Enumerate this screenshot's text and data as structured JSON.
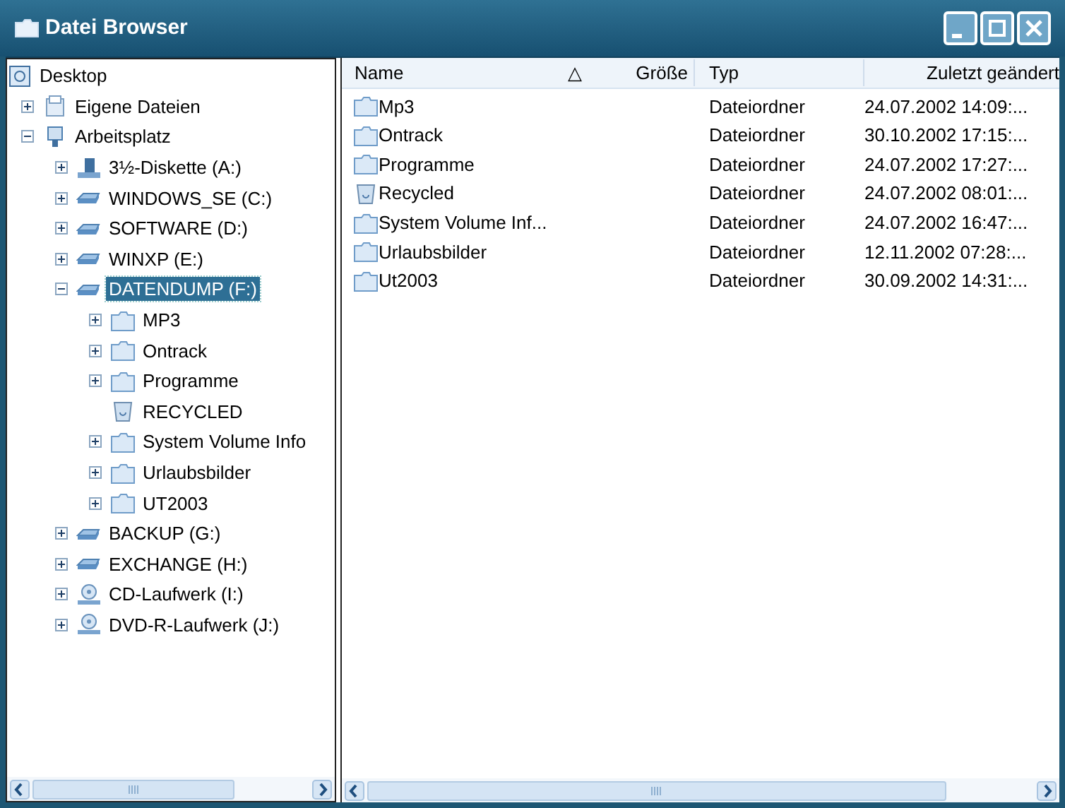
{
  "window": {
    "title": "Datei Browser"
  },
  "tree": [
    {
      "label": "Desktop",
      "kind": "desktop",
      "selected": false,
      "children": [
        {
          "label": "Eigene Dateien",
          "kind": "documents",
          "expanded": false,
          "selected": false
        },
        {
          "label": "Arbeitsplatz",
          "kind": "computer",
          "expanded": true,
          "selected": false,
          "children": [
            {
              "label": "3½-Diskette (A:)",
              "kind": "floppy",
              "expanded": false,
              "selected": false
            },
            {
              "label": "WINDOWS_SE (C:)",
              "kind": "drive",
              "expanded": false,
              "selected": false
            },
            {
              "label": "SOFTWARE (D:)",
              "kind": "drive",
              "expanded": false,
              "selected": false
            },
            {
              "label": "WINXP (E:)",
              "kind": "drive",
              "expanded": false,
              "selected": false
            },
            {
              "label": "DATENDUMP (F:)",
              "kind": "drive",
              "expanded": true,
              "selected": true,
              "children": [
                {
                  "label": "MP3",
                  "kind": "folder",
                  "expanded": false,
                  "selected": false
                },
                {
                  "label": "Ontrack",
                  "kind": "folder",
                  "expanded": false,
                  "selected": false
                },
                {
                  "label": "Programme",
                  "kind": "folder",
                  "expanded": false,
                  "selected": false
                },
                {
                  "label": "RECYCLED",
                  "kind": "recycle",
                  "selected": false
                },
                {
                  "label": "System Volume Info",
                  "kind": "folder",
                  "expanded": false,
                  "selected": false
                },
                {
                  "label": "Urlaubsbilder",
                  "kind": "folder",
                  "expanded": false,
                  "selected": false
                },
                {
                  "label": "UT2003",
                  "kind": "folder",
                  "expanded": false,
                  "selected": false
                }
              ]
            },
            {
              "label": "BACKUP (G:)",
              "kind": "drive",
              "expanded": false,
              "selected": false
            },
            {
              "label": "EXCHANGE (H:)",
              "kind": "drive",
              "expanded": false,
              "selected": false
            },
            {
              "label": "CD-Laufwerk (I:)",
              "kind": "cdrom",
              "expanded": false,
              "selected": false
            },
            {
              "label": "DVD-R-Laufwerk (J:)",
              "kind": "cdrom",
              "expanded": false,
              "selected": false
            }
          ]
        }
      ]
    }
  ],
  "table": {
    "columns": [
      "Name",
      "Größe",
      "Typ",
      "Zuletzt geändert"
    ],
    "sort_mark": "△",
    "rows": [
      {
        "kind": "folder",
        "name": "Mp3",
        "type": "Dateiordner",
        "modified": "24.07.2002 14:09:..."
      },
      {
        "kind": "folder",
        "name": "Ontrack",
        "type": "Dateiordner",
        "modified": "30.10.2002 17:15:..."
      },
      {
        "kind": "folder",
        "name": "Programme",
        "type": "Dateiordner",
        "modified": "24.07.2002 17:27:..."
      },
      {
        "kind": "recycle",
        "name": "Recycled",
        "type": "Dateiordner",
        "modified": "24.07.2002 08:01:..."
      },
      {
        "kind": "folder",
        "name": "System Volume Inf...",
        "type": "Dateiordner",
        "modified": "24.07.2002 16:47:..."
      },
      {
        "kind": "folder",
        "name": "Urlaubsbilder",
        "type": "Dateiordner",
        "modified": "12.11.2002 07:28:..."
      },
      {
        "kind": "folder",
        "name": "Ut2003",
        "type": "Dateiordner",
        "modified": "30.09.2002 14:31:..."
      }
    ]
  }
}
